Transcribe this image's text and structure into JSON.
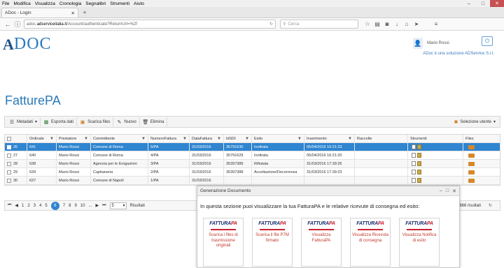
{
  "browser": {
    "menu": [
      "File",
      "Modifica",
      "Visualizza",
      "Cronologia",
      "Segnalibri",
      "Strumenti",
      "Aiuto"
    ],
    "tab_title": "ADoc - Login",
    "url_prefix": "adoc.",
    "url_domain": "adserviceitalia.it",
    "url_path": "/Account/authenticate?ReturnUrl=%2f",
    "search_placeholder": "Cerca"
  },
  "header": {
    "logo_a": "A",
    "logo_doc": "DOC",
    "user_name": "Mario Rossi",
    "tagline": "ADoc è una soluzione ADService S.r.l."
  },
  "page": {
    "title": "FatturePA"
  },
  "toolbar": {
    "metadati": "Metadati",
    "esporta": "Esporta dati",
    "scarica": "Scarica files",
    "nuovo": "Nuovo",
    "elimina": "Elimina",
    "selezione": "Selezione utente"
  },
  "grid": {
    "headers": [
      "Ordinale",
      "Prestatore",
      "Committente",
      "NumeroFattura",
      "DataFattura",
      "IdSDI",
      "Esito",
      "Inserimento",
      "Raccolte",
      "Strumenti",
      "Files"
    ],
    "rows": [
      {
        "idx": "26",
        "ordinale": "641",
        "prestatore": "Mario Rossi",
        "committente": "Comune di Roma",
        "numero": "5/PA",
        "data": "31/03/2016",
        "idsdi": "35791630",
        "esito": "Inoltrata",
        "inserimento": "05/04/2016 16:21:23"
      },
      {
        "idx": "27",
        "ordinale": "640",
        "prestatore": "Mario Rossi",
        "committente": "Comune di Roma",
        "numero": "4/PA",
        "data": "31/03/2016",
        "idsdi": "35791629",
        "esito": "Inoltrata",
        "inserimento": "05/04/2016 16:21:20"
      },
      {
        "idx": "28",
        "ordinale": "638",
        "prestatore": "Mario Rossi",
        "committente": "Agenzia per le Erogazioni",
        "numero": "3/PA",
        "data": "31/03/2016",
        "idsdi": "35397389",
        "esito": "Rifiutata",
        "inserimento": "31/03/2016 17:39:26"
      },
      {
        "idx": "29",
        "ordinale": "639",
        "prestatore": "Mario Rossi",
        "committente": "Capitaneria",
        "numero": "2/PA",
        "data": "31/03/2016",
        "idsdi": "35397388",
        "esito": "Accettazione/Decorrenza",
        "inserimento": "31/03/2016 17:39:23"
      },
      {
        "idx": "30",
        "ordinale": "637",
        "prestatore": "Mario Rossi",
        "committente": "Comune di Napoli",
        "numero": "1/PA",
        "data": "31/03/2016",
        "idsdi": "",
        "esito": "",
        "inserimento": ""
      }
    ]
  },
  "pager": {
    "pages": [
      "1",
      "2",
      "3",
      "4",
      "5",
      "6",
      "7",
      "8",
      "9",
      "10",
      "..."
    ],
    "current": "6",
    "size": "5",
    "result_label": "Risultati",
    "total": "666 risultati"
  },
  "modal": {
    "title": "Generazione Documento",
    "text": "In questa sezione puoi visualizzare la tua FatturaPA e le relative ricevute di consegna ed esito:",
    "logo_main": "FATTURA",
    "logo_pa": "PA",
    "cards": [
      "Scarica i files di trasmissione originali",
      "Scarica il file P7M firmato",
      "Visualizza FatturaPA",
      "Visualizza Ricevuta di consegna",
      "Visualizza Notifica di esito"
    ]
  },
  "colors": {
    "accent": "#2f85d0",
    "title": "#2a7ab8",
    "card_text": "#c0392b"
  }
}
